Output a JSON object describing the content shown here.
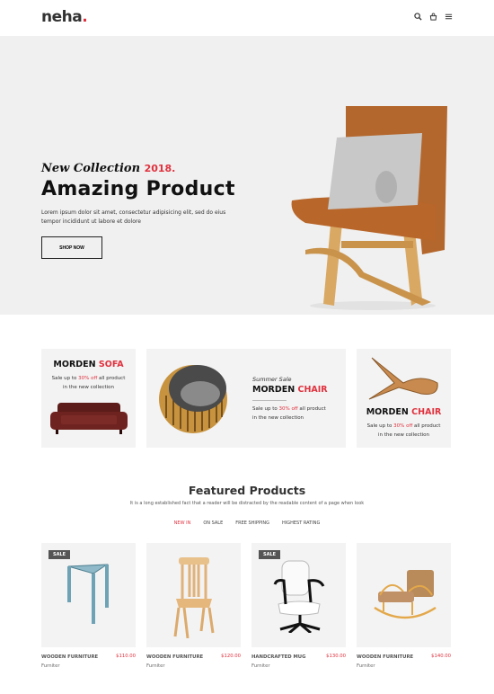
{
  "header": {
    "logo": "neha",
    "logo_dot": ".",
    "icons": [
      "search-icon",
      "cart-icon",
      "menu-icon"
    ]
  },
  "hero": {
    "script_text": "New Collection",
    "year": "2018.",
    "title": "Amazing Product",
    "description": "Lorem ipsum dolor sit amet, consectetur adipisicing elit, sed do eius tempor incididunt ut labore et dolore",
    "button": "SHOP NOW"
  },
  "banners": [
    {
      "title_a": "MORDEN",
      "title_b": "SOFA",
      "line1_a": "Sale up to",
      "line1_hl": "30% off",
      "line1_b": "all product",
      "line2": "in the new collection"
    },
    {
      "kicker": "Summer Sale",
      "title_a": "MORDEN",
      "title_b": "CHAIR",
      "line1_a": "Sale up to",
      "line1_hl": "30% off",
      "line1_b": "all product",
      "line2": "in the new collection"
    },
    {
      "title_a": "MORDEN",
      "title_b": "CHAIR",
      "line1_a": "Sale up to",
      "line1_hl": "30% off",
      "line1_b": "all product",
      "line2": "in the new collection"
    }
  ],
  "featured": {
    "title": "Featured Products",
    "subtitle": "It is a long established fact that a reader will be distracted by the readable content of a page when look",
    "tabs": [
      {
        "label": "NEW IN",
        "active": true
      },
      {
        "label": "ON SALE"
      },
      {
        "label": "FREE SHIPPING"
      },
      {
        "label": "HIGHEST RATING"
      }
    ]
  },
  "products": [
    {
      "name": "WOODEN FURNITURE",
      "price": "$110.00",
      "category": "Furniter",
      "badge": "SALE"
    },
    {
      "name": "WOODEN FURNITURE",
      "price": "$120.00",
      "category": "Furniter",
      "badge": null
    },
    {
      "name": "HANDCRAFTED MUG",
      "price": "$130.00",
      "category": "Furniter",
      "badge": "SALE"
    },
    {
      "name": "WOODEN FURNITURE",
      "price": "$140.00",
      "category": "Furniter",
      "badge": null
    }
  ],
  "colors": {
    "accent": "#e0323e",
    "hero_bg": "#f0f0f0",
    "card_bg": "#f3f3f3"
  }
}
